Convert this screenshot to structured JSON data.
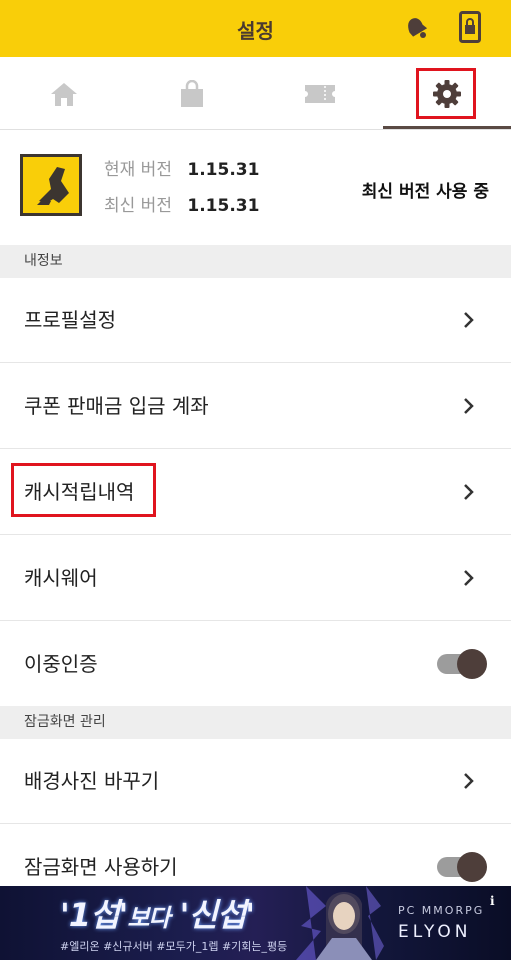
{
  "header": {
    "title": "설정",
    "icons": [
      "bell-icon",
      "phone-lock-icon"
    ]
  },
  "tabs": [
    {
      "name": "home",
      "icon": "home-icon"
    },
    {
      "name": "shop",
      "icon": "shopping-bag-icon"
    },
    {
      "name": "coupon",
      "icon": "ticket-icon"
    },
    {
      "name": "settings",
      "icon": "gear-icon",
      "selected": true
    }
  ],
  "version": {
    "current_label": "현재 버전",
    "current_value": "1.15.31",
    "latest_label": "최신 버전",
    "latest_value": "1.15.31",
    "status": "최신 버전 사용 중"
  },
  "sections": {
    "my_info": {
      "title": "내정보",
      "items": [
        {
          "label": "프로필설정",
          "control": "chevron"
        },
        {
          "label": "쿠폰 판매금 입금 계좌",
          "control": "chevron"
        },
        {
          "label": "캐시적립내역",
          "control": "chevron"
        },
        {
          "label": "캐시웨어",
          "control": "chevron"
        },
        {
          "label": "이중인증",
          "control": "toggle",
          "on": true
        }
      ]
    },
    "lock_screen": {
      "title": "잠금화면 관리",
      "items": [
        {
          "label": "배경사진 바꾸기",
          "control": "chevron"
        },
        {
          "label": "잠금화면 사용하기",
          "control": "toggle",
          "on": true
        }
      ]
    }
  },
  "ad": {
    "headline_1": "'1섭'",
    "headline_2": "보다",
    "headline_3": "'신섭'",
    "tags": "#엘리온 #신규서버 #모두가_1렙 #기회는_평등",
    "sub": "PC MMORPG",
    "brand": "ELYON",
    "info": "i"
  },
  "colors": {
    "accent": "#f9ce09",
    "highlight_box": "#e0141e",
    "dark_brown": "#4e3e3a"
  }
}
